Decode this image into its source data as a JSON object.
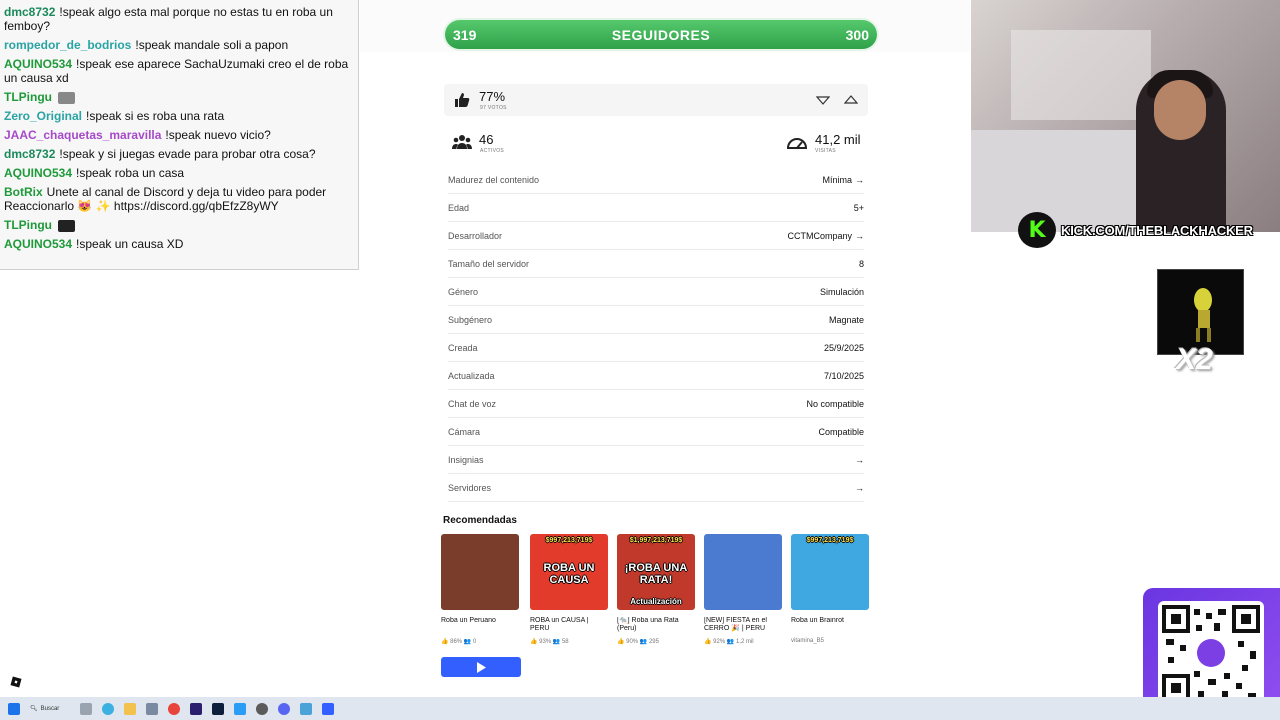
{
  "chat": {
    "messages": [
      {
        "user": "dmc8732",
        "user_color": "#1b8a5a",
        "text": "!speak algo esta mal porque no estas tu en roba un femboy?"
      },
      {
        "user": "rompedor_de_bodrios",
        "user_color": "#2aa3a3",
        "text": "!speak mandale soli a papon"
      },
      {
        "user": "AQUINO534",
        "user_color": "#1f9a3a",
        "text": "!speak ese aparece SachaUzumaki creo el de roba un causa xd"
      },
      {
        "user": "TLPingu",
        "user_color": "#1f9a3a",
        "text": ""
      },
      {
        "user": "Zero_Original",
        "user_color": "#2aa3a3",
        "text": "!speak si es roba una rata"
      },
      {
        "user": "JAAC_chaquetas_maravilla",
        "user_color": "#a64ac9",
        "text": "!speak nuevo vicio?"
      },
      {
        "user": "dmc8732",
        "user_color": "#1b8a5a",
        "text": "!speak y si juegas evade para probar otra cosa?"
      },
      {
        "user": "AQUINO534",
        "user_color": "#1f9a3a",
        "text": "!speak roba un casa"
      },
      {
        "user": "BotRix",
        "user_color": "#1f9a3a",
        "text": "Unete al canal de Discord y deja tu video para poder Reaccionarlo 😻 ✨ https://discord.gg/qbEfzZ8yWY"
      },
      {
        "user": "TLPingu",
        "user_color": "#1f9a3a",
        "text": ""
      },
      {
        "user": "AQUINO534",
        "user_color": "#1f9a3a",
        "text": "!speak un causa XD"
      }
    ]
  },
  "followers": {
    "current": "319",
    "label": "SEGUIDORES",
    "goal": "300",
    "color": "#3cb558"
  },
  "votes": {
    "percent": "77%",
    "sub": "97 VOTOS"
  },
  "stats": {
    "active": "46",
    "active_label": "ACTIVOS",
    "visits": "41,2 mil",
    "visits_label": "VISITAS"
  },
  "info_rows": [
    {
      "label": "Madurez del contenido",
      "value": "Mínima",
      "arrow": "→"
    },
    {
      "label": "Edad",
      "value": "5+",
      "arrow": ""
    },
    {
      "label": "Desarrollador",
      "value": "CCTMCompany",
      "arrow": "→"
    },
    {
      "label": "Tamaño del servidor",
      "value": "8",
      "arrow": ""
    },
    {
      "label": "Género",
      "value": "Simulación",
      "arrow": ""
    },
    {
      "label": "Subgénero",
      "value": "Magnate",
      "arrow": ""
    },
    {
      "label": "Creada",
      "value": "25/9/2025",
      "arrow": ""
    },
    {
      "label": "Actualizada",
      "value": "7/10/2025",
      "arrow": ""
    },
    {
      "label": "Chat de voz",
      "value": "No compatible",
      "arrow": ""
    },
    {
      "label": "Cámara",
      "value": "Compatible",
      "arrow": ""
    },
    {
      "label": "Insignias",
      "value": "",
      "arrow": "→"
    },
    {
      "label": "Servidores",
      "value": "",
      "arrow": "→"
    }
  ],
  "recommended": {
    "title": "Recomendadas",
    "items": [
      {
        "title": "Roba un Peruano",
        "meta": "👍 86%  👥 0",
        "thumb_text": "",
        "bg": "#7a3d2b"
      },
      {
        "title": "ROBA un CAUSA | PERU",
        "meta": "👍 93%  👥 58",
        "thumb_text": "ROBA UN CAUSA",
        "bg": "#e23b2c"
      },
      {
        "title": "[🐀] Roba una Rata (Peru)",
        "meta": "👍 90%  👥 295",
        "thumb_text": "¡ROBA UNA RATA!",
        "bg": "#c0392b"
      },
      {
        "title": "[NEW] FIESTA en el CERRO 🎉 | PERU",
        "meta": "👍 92%  👥 1,2 mil",
        "thumb_text": "",
        "bg": "#4a7bd0"
      },
      {
        "title": "Roba un Brainrot",
        "meta": "vitamina_B5",
        "thumb_text": "",
        "bg": "#3fa8e0"
      }
    ],
    "thumb_top_texts": [
      "",
      "$997,213,719$",
      "$1,997,213,719$",
      "",
      "$997,213,719$"
    ],
    "thumb_bottom_texts": [
      "",
      "",
      "Actualización",
      "",
      ""
    ]
  },
  "webcam": {
    "banner": "KICK.COM/THEBLACKHACKER",
    "kick_letter": "K",
    "multiplier": "X2"
  },
  "taskbar": {
    "search": "Buscar"
  }
}
